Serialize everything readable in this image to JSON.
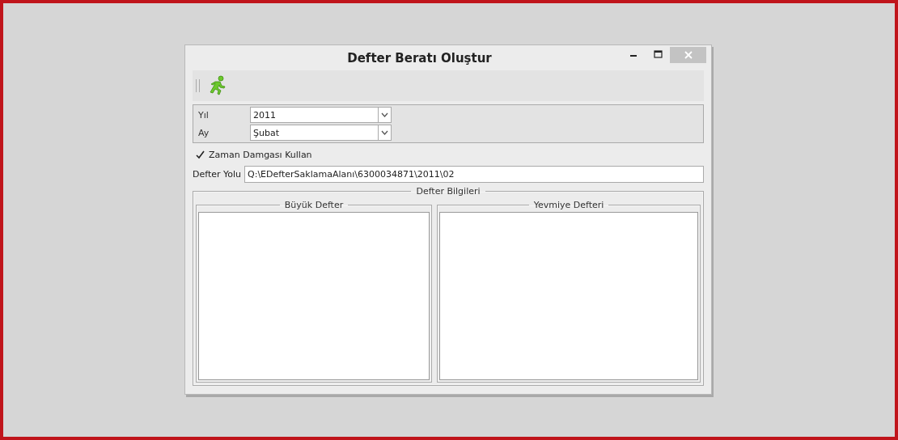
{
  "window": {
    "title": "Defter Beratı Oluştur"
  },
  "filters": [
    {
      "label": "Yıl",
      "value": "2011"
    },
    {
      "label": "Ay",
      "value": "Şubat"
    }
  ],
  "timestamp": {
    "label": "Zaman Damgası Kullan",
    "checked": true
  },
  "path": {
    "label": "Defter Yolu",
    "value": "Q:\\EDefterSaklamaAlanı\\6300034871\\2011\\02"
  },
  "info": {
    "title": "Defter Bilgileri",
    "panels": [
      {
        "title": "Büyük Defter"
      },
      {
        "title": "Yevmiye Defteri"
      }
    ]
  }
}
